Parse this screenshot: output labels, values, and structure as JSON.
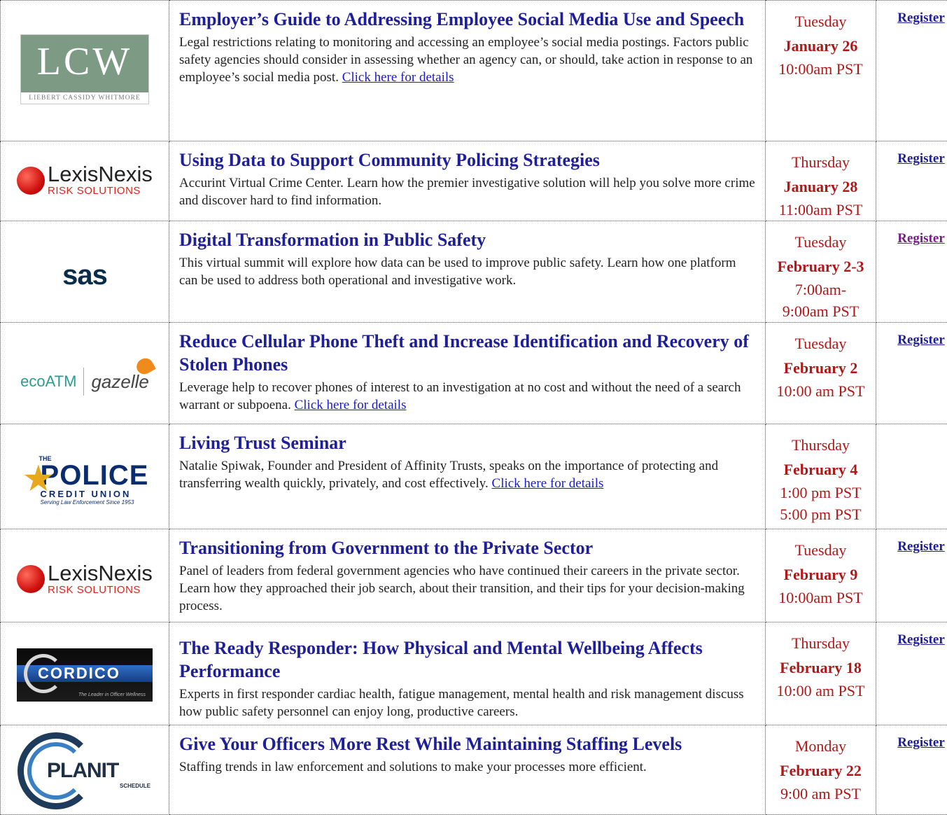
{
  "register_label": "Register",
  "events": [
    {
      "logo": {
        "name": "lcw-logo",
        "main": "LCW",
        "sub": "LIEBERT CASSIDY WHITMORE"
      },
      "title": "Employer’s Guide to Addressing Employee Social Media Use and Speech",
      "body": "Legal restrictions relating to monitoring and accessing an employee’s social media postings.  Factors public safety agencies should consider in assessing whether an agency can, or should, take action in response to an employee’s social media post. ",
      "link": "Click here for details",
      "day": "Tuesday",
      "date": "January 26",
      "times": [
        "10:00am PST"
      ],
      "register": "Register"
    },
    {
      "logo": {
        "name": "lexisnexis-logo",
        "main": "LexisNexis",
        "sub": "RISK SOLUTIONS"
      },
      "title": "Using Data to Support Community Policing Strategies",
      "body": "Accurint Virtual Crime Center.  Learn how the premier investigative solution will help you solve more crime and discover hard to find information.",
      "link": "",
      "day": "Thursday",
      "date": "January 28",
      "times": [
        "11:00am PST"
      ],
      "register": "Register"
    },
    {
      "logo": {
        "name": "sas-logo",
        "main": "sas"
      },
      "title": "Digital Transformation in Public Safety",
      "body": "This virtual summit will explore how data can be used to improve public safety.  Learn how one platform can be used to address both operational and investigative work.",
      "link": "",
      "day": "Tuesday",
      "date": "February 2-3",
      "times": [
        "7:00am-",
        "9:00am PST"
      ],
      "register": "Register"
    },
    {
      "logo": {
        "name": "ecoatm-gazelle-logo",
        "main": "ecoATM",
        "sub": "gazelle"
      },
      "title": "Reduce Cellular Phone Theft and Increase Identification and Recovery of Stolen Phones",
      "body": "Leverage help to recover phones of interest to an investigation at no cost and without the need of a search warrant or subpoena. ",
      "link": "Click here for details",
      "day": "Tuesday",
      "date": "February 2",
      "times": [
        "10:00 am PST"
      ],
      "register": "Register"
    },
    {
      "logo": {
        "name": "police-credit-union-logo",
        "the": "THE",
        "main": "POLICE",
        "sub": "CREDIT UNION",
        "tag": "Serving Law Enforcement Since 1953"
      },
      "title": "Living Trust Seminar",
      "body": "Natalie Spiwak, Founder and President of Affinity Trusts, speaks on the importance of protecting and transferring wealth quickly, privately, and cost effectively.  ",
      "link": "Click here for details",
      "day": "Thursday",
      "date": "February 4",
      "times": [
        "1:00 pm PST",
        "5:00 pm PST"
      ],
      "register": ""
    },
    {
      "logo": {
        "name": "lexisnexis-logo",
        "main": "LexisNexis",
        "sub": "RISK SOLUTIONS"
      },
      "title": "Transitioning from Government to the Private Sector",
      "body": "Panel of leaders from federal government agencies who have continued their careers in the private sector.  Learn how they approached their job search, about their transition, and their tips for your decision-making process.",
      "link": "",
      "day": "Tuesday",
      "date": "February 9",
      "times": [
        "10:00am PST"
      ],
      "register": "Register"
    },
    {
      "logo": {
        "name": "cordico-logo",
        "main": "CORDICO",
        "tag": "The Leader in Officer Wellness"
      },
      "title": "The Ready Responder: How Physical and Mental Wellbeing Affects Performance",
      "body": "Experts in first responder cardiac health, fatigue management, mental health and risk management discuss how public safety personnel can enjoy long, productive careers.",
      "link": "",
      "day": "Thursday",
      "date": "February 18",
      "times": [
        "10:00 am PST"
      ],
      "register": "Register"
    },
    {
      "logo": {
        "name": "planit-schedule-logo",
        "main": "PLANIT",
        "sub": "SCHEDULE"
      },
      "title": "Give Your Officers More Rest While Maintaining Staffing Levels",
      "body": "Staffing trends in law enforcement and solutions to make your processes more efficient.",
      "link": "",
      "day": "Monday",
      "date": "February 22",
      "times": [
        "9:00 am PST"
      ],
      "register": "Register"
    }
  ]
}
